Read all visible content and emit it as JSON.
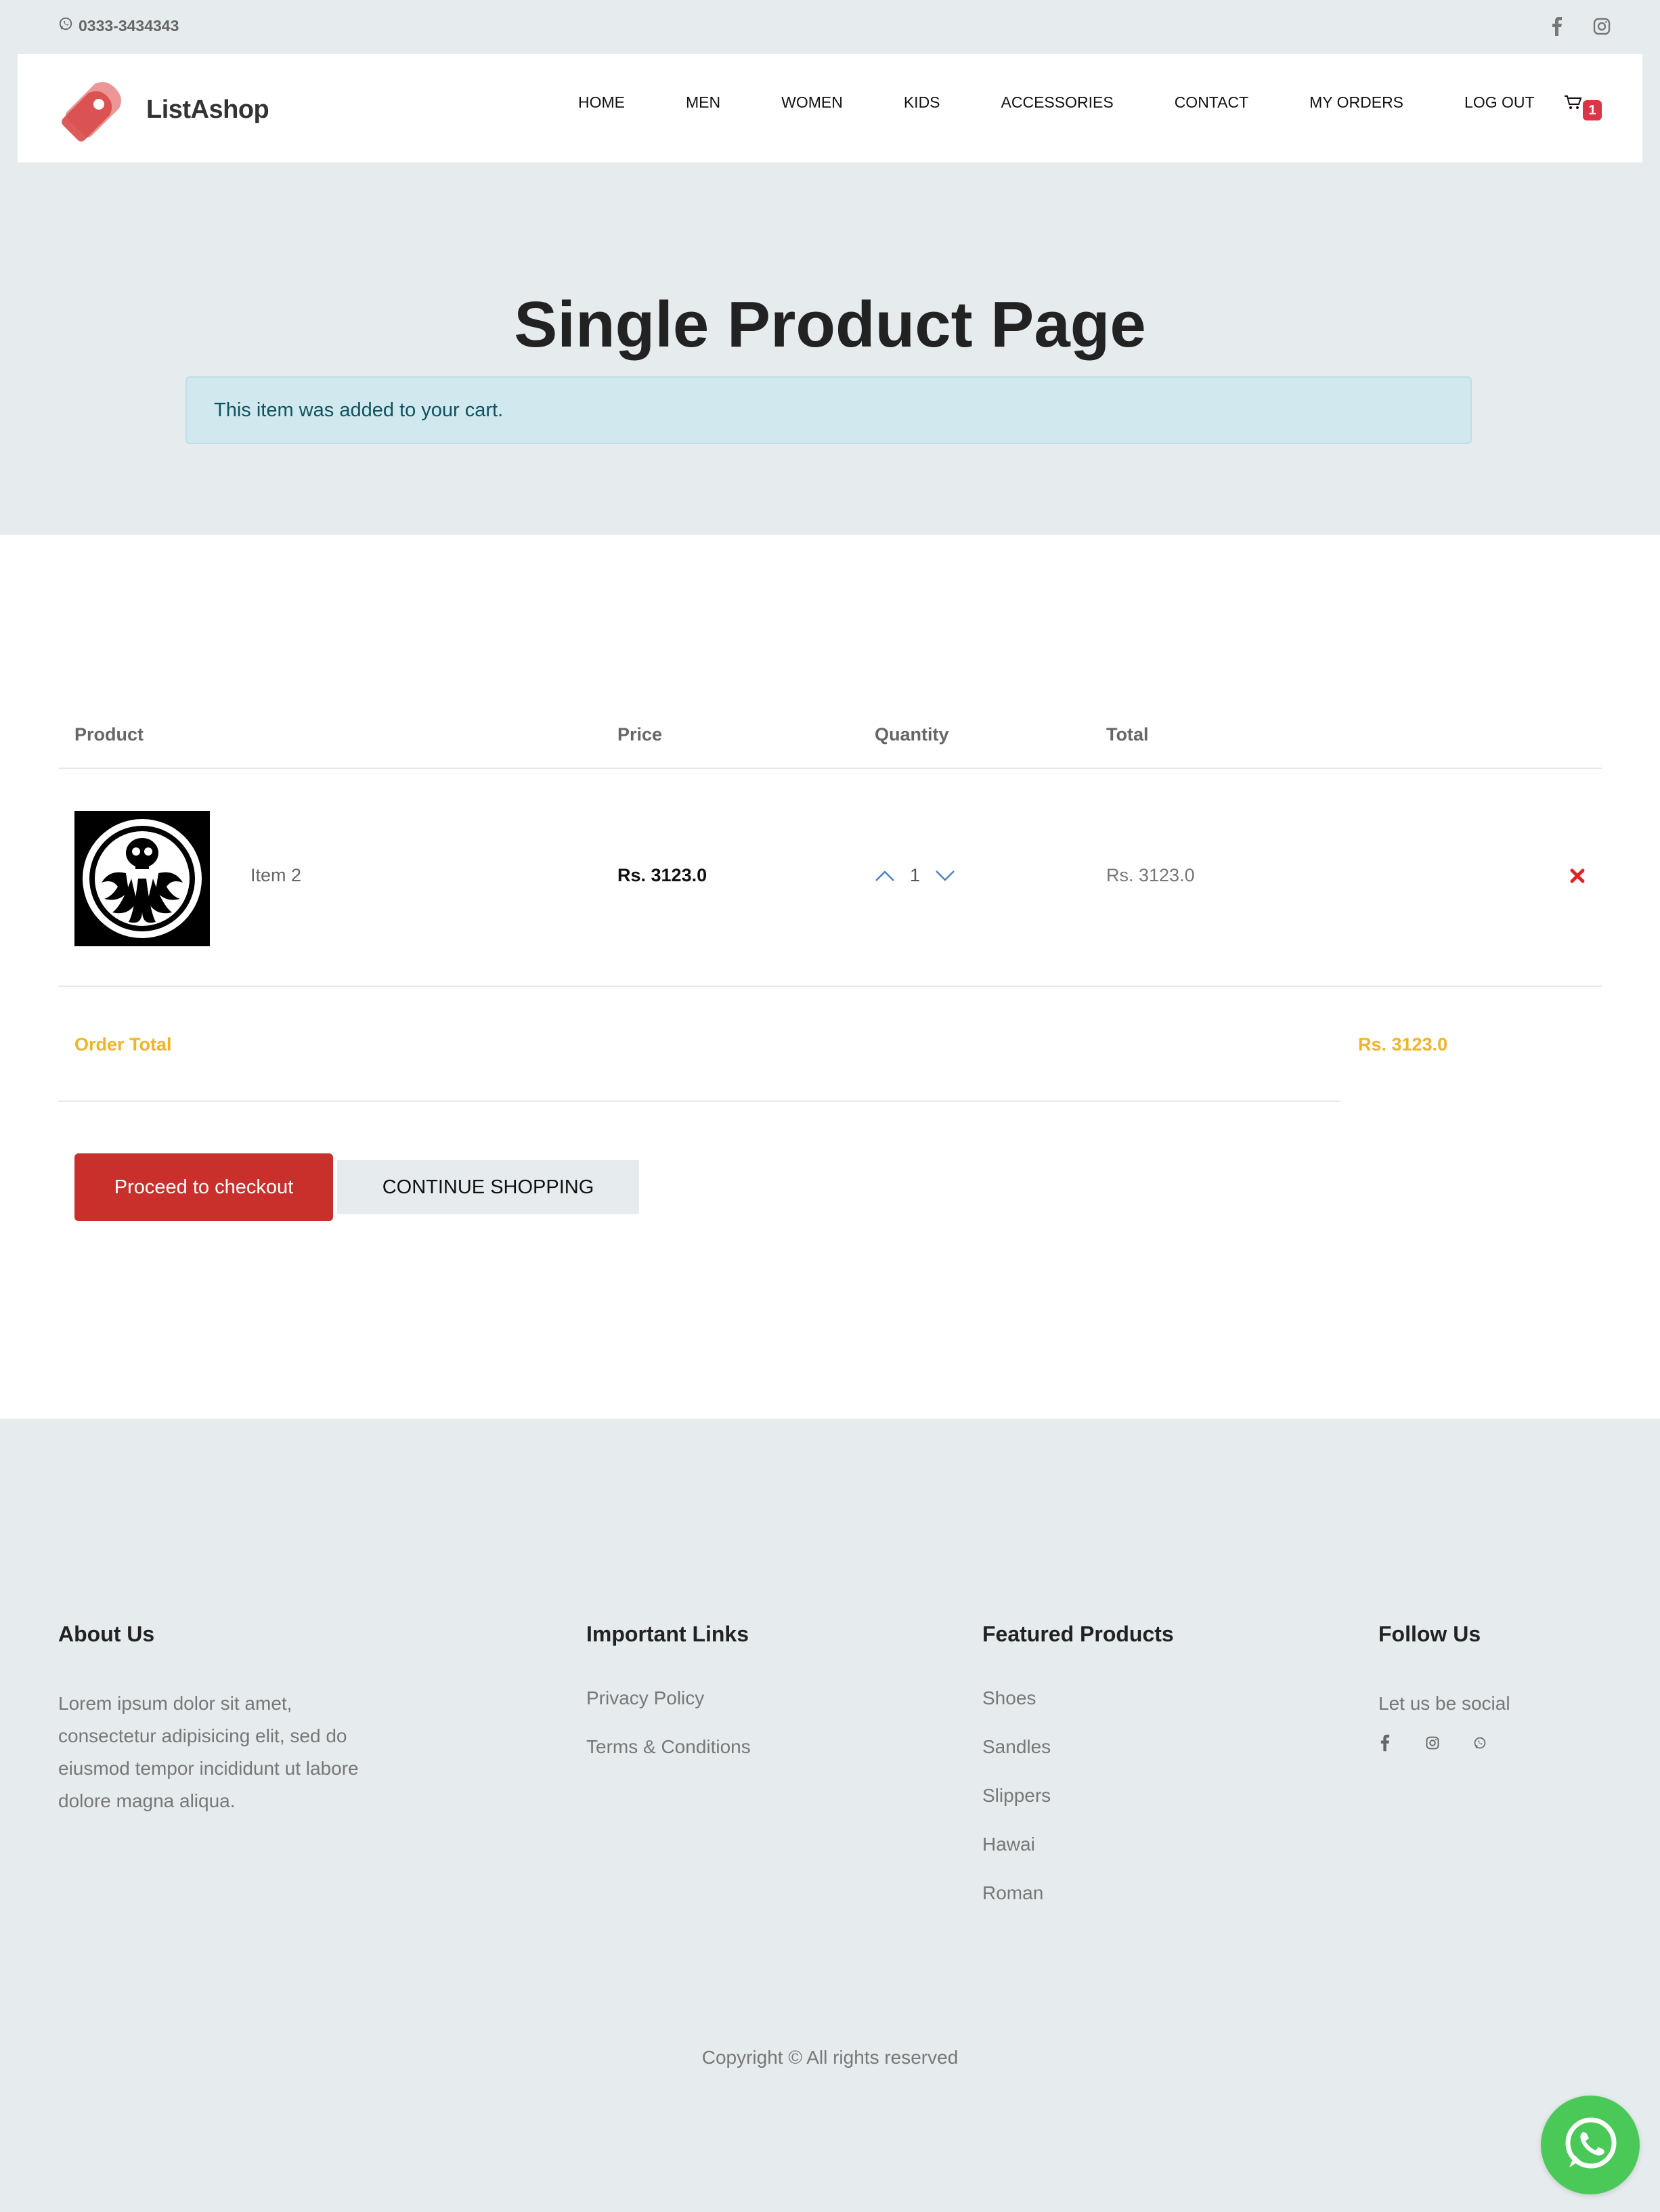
{
  "topbar": {
    "phone": "0333-3434343",
    "phone_icon": "whatsapp-icon",
    "social_icons": [
      "facebook-icon",
      "instagram-icon"
    ]
  },
  "header": {
    "brand": "ListAshop",
    "nav": [
      "HOME",
      "MEN",
      "WOMEN",
      "KIDS",
      "ACCESSORIES",
      "CONTACT",
      "MY ORDERS",
      "LOG OUT"
    ],
    "cart_count": "1"
  },
  "hero": {
    "title": "Single Product Page",
    "alert": "This item was added to your cart."
  },
  "cart": {
    "headers": {
      "product": "Product",
      "price": "Price",
      "quantity": "Quantity",
      "total": "Total"
    },
    "items": [
      {
        "name": "Item 2",
        "price": "Rs. 3123.0",
        "quantity": "1",
        "total": "Rs. 3123.0"
      }
    ],
    "order_total_label": "Order Total",
    "order_total_value": "Rs. 3123.0",
    "checkout_label": "Proceed to checkout",
    "continue_label": "CONTINUE SHOPPING"
  },
  "footer": {
    "about": {
      "title": "About Us",
      "text": "Lorem ipsum dolor sit amet, consectetur adipisicing elit, sed do eiusmod tempor incididunt ut labore dolore magna aliqua."
    },
    "links": {
      "title": "Important Links",
      "items": [
        "Privacy Policy",
        "Terms & Conditions"
      ]
    },
    "featured": {
      "title": "Featured Products",
      "items": [
        "Shoes",
        "Sandles",
        "Slippers",
        "Hawai",
        "Roman"
      ]
    },
    "follow": {
      "title": "Follow Us",
      "text": "Let us be social",
      "icons": [
        "facebook-icon",
        "instagram-icon",
        "whatsapp-icon"
      ]
    },
    "copyright": "Copyright © All rights reserved"
  },
  "colors": {
    "accent_red": "#c9302c",
    "order_total": "#f0b429",
    "alert_bg": "#d1e9ee",
    "whatsapp_green": "#4ac959",
    "page_bg": "#e6ecee"
  }
}
